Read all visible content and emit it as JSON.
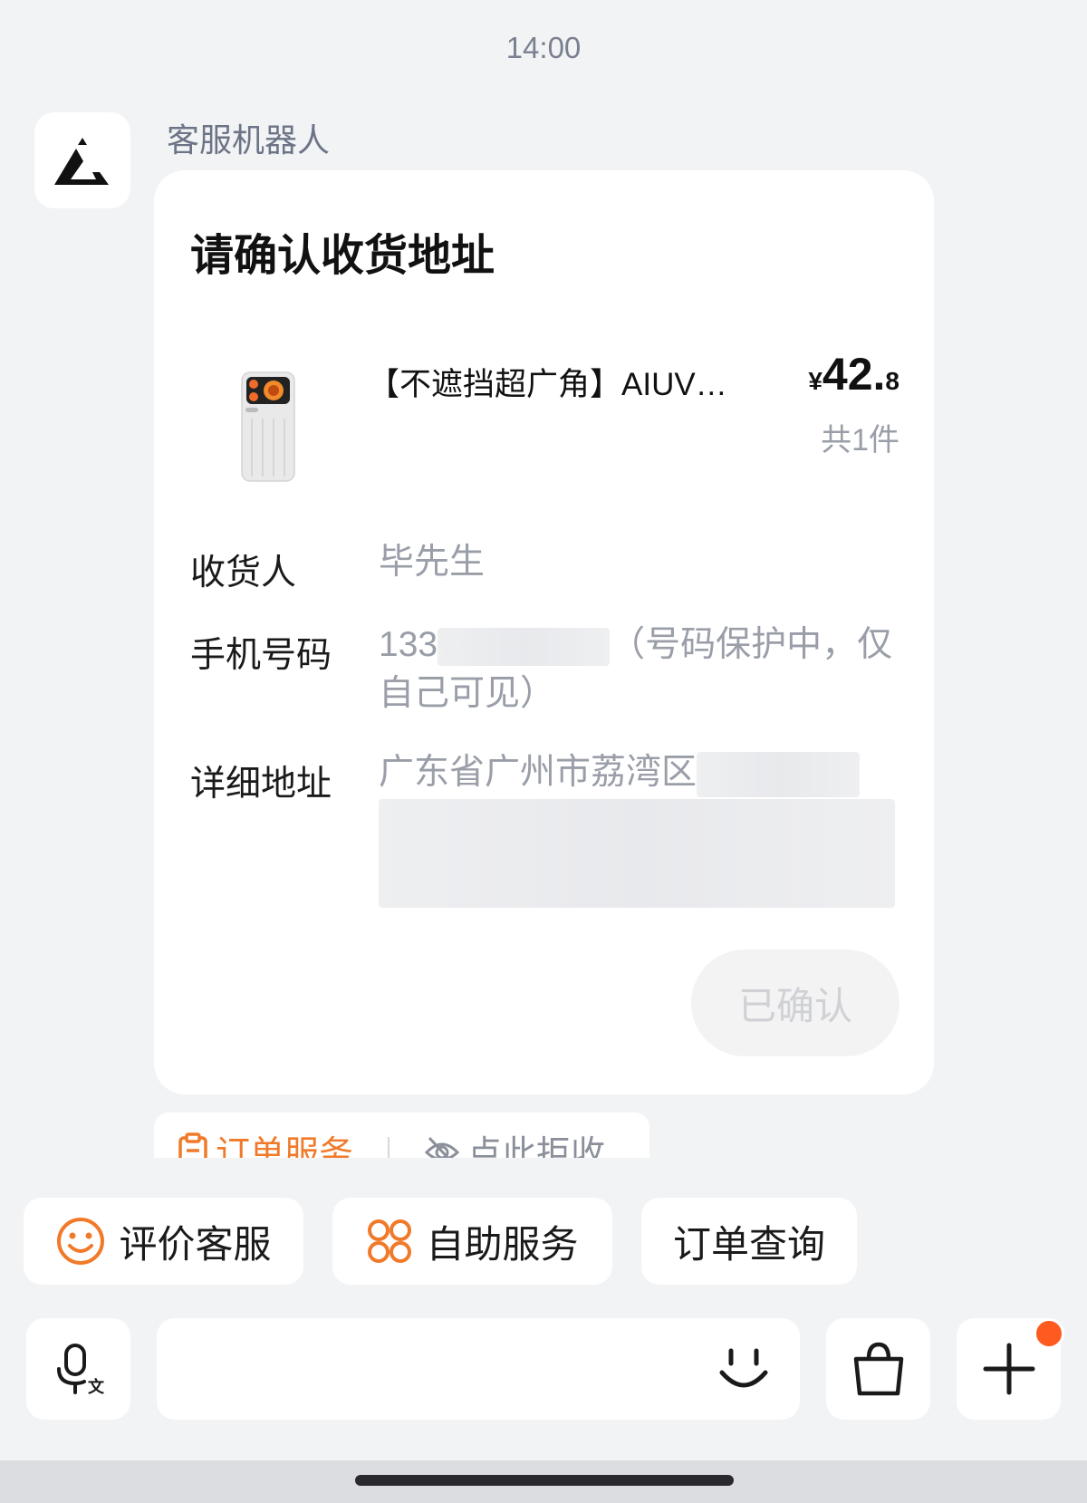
{
  "chat": {
    "timestamp": "14:00",
    "sender_name": "客服机器人"
  },
  "address_card": {
    "title": "请确认收货地址",
    "product": {
      "name": "【不遮挡超广角】AIUV…",
      "price_symbol": "¥",
      "price_int": "42.",
      "price_dec": "8",
      "quantity": "共1件"
    },
    "fields": {
      "recipient_label": "收货人",
      "recipient_value": "毕先生",
      "phone_label": "手机号码",
      "phone_prefix": "133",
      "phone_note": "（号码保护中，仅自己可见）",
      "address_label": "详细地址",
      "address_value": "广东省广州市荔湾区"
    },
    "confirm_button": "已确认"
  },
  "order_strip": {
    "order_service": "订单服务",
    "reject_label": "点此拒收"
  },
  "quick_actions": [
    {
      "label": "评价客服",
      "icon": "smile-face-icon"
    },
    {
      "label": "自助服务",
      "icon": "grid-circles-icon"
    },
    {
      "label": "订单查询",
      "icon": ""
    }
  ],
  "input_bar": {
    "placeholder": "",
    "voice_icon": "voice-translate-icon",
    "emoji_icon": "emoji-icon",
    "bag_icon": "shopping-bag-icon",
    "plus_icon": "plus-icon"
  },
  "colors": {
    "accent_orange": "#f07a2a",
    "badge_red": "#ff5a1f",
    "background": "#f2f3f5"
  }
}
